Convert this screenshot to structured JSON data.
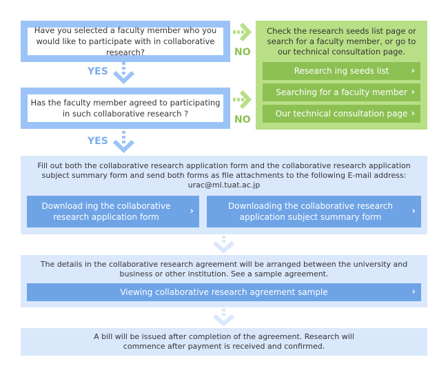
{
  "questions": [
    {
      "text": "Have you selected a faculty member who you would like to participate with in collaborative research?"
    },
    {
      "text": "Has the faculty member agreed to participating in such collaborative research ?"
    }
  ],
  "labels": {
    "yes": "YES",
    "no": "NO"
  },
  "no_panel": {
    "text": "Check the research seeds list page or search for a faculty member, or go to our technical consultation page.",
    "buttons": [
      {
        "label": "Research ing seeds list"
      },
      {
        "label": "Searching for a faculty member"
      },
      {
        "label": "Our technical consultation page"
      }
    ]
  },
  "step_application": {
    "text": "Fill out both the collaborative research application form and the collaborative research application subject summary form and send both forms as file attachments to the following E-mail address: urac@ml.tuat.ac.jp",
    "buttons": [
      {
        "label": "Download ing the collaborative research application form"
      },
      {
        "label": "Downloading the collaborative research application subject summary form"
      }
    ]
  },
  "step_agreement": {
    "text": "The details in the collaborative research agreement will be arranged between the university and business or other institution. See a sample agreement.",
    "button": {
      "label": "Viewing collaborative research agreement sample"
    }
  },
  "step_bill": {
    "text": "A bill will be issued after completion of the agreement. Research will commence after payment is received and confirmed."
  },
  "icons": {
    "chevron": "›"
  },
  "colors": {
    "blue_box": "#9cc3f7",
    "green_panel": "#b8df85",
    "green_button": "#8dc052",
    "blue_panel": "#dae8fc",
    "blue_button": "#6ea3e6",
    "yes": "#7aacef",
    "no": "#8cc152"
  }
}
